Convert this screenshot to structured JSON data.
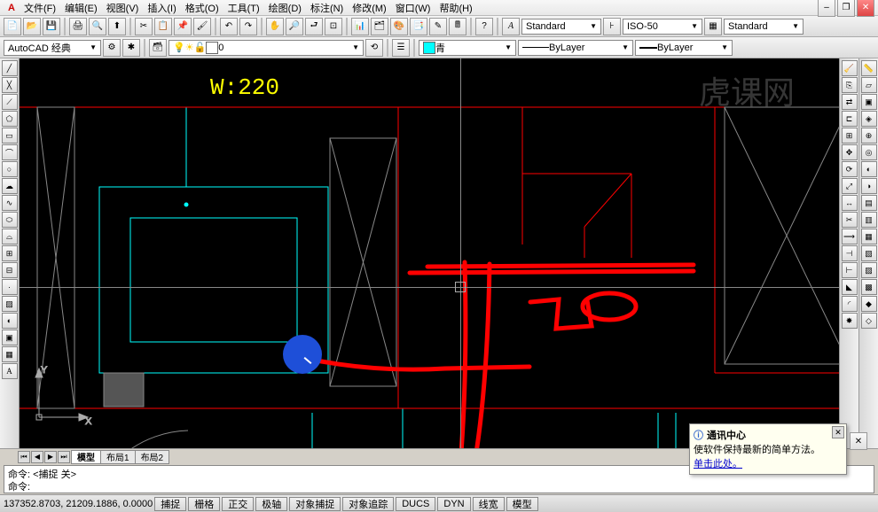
{
  "menu": {
    "file": "文件(F)",
    "edit": "编辑(E)",
    "view": "视图(V)",
    "insert": "插入(I)",
    "format": "格式(O)",
    "tools": "工具(T)",
    "draw": "绘图(D)",
    "dim": "标注(N)",
    "modify": "修改(M)",
    "window": "窗口(W)",
    "help": "帮助(H)"
  },
  "toolbar1": {
    "workspace": "AutoCAD 经典",
    "layervalue": "0"
  },
  "toolbar2": {
    "color_name": "青",
    "linetype": "ByLayer",
    "lineweight": "ByLayer",
    "textstyle": "Standard",
    "dimstyle": "ISO-50",
    "tablestyle": "Standard"
  },
  "drawing": {
    "dim_text": "W:220"
  },
  "tabs": {
    "model": "模型",
    "layout1": "布局1",
    "layout2": "布局2"
  },
  "cmd": {
    "hist": "命令: <捕捉 关>",
    "prompt": "命令: "
  },
  "status": {
    "coords": "137352.8703, 21209.1886, 0.0000",
    "snap": "捕捉",
    "grid": "栅格",
    "ortho": "正交",
    "polar": "极轴",
    "osnap": "对象捕捉",
    "otrack": "对象追踪",
    "ducs": "DUCS",
    "dyn": "DYN",
    "lwt": "线宽",
    "model": "模型"
  },
  "notif": {
    "title": "通讯中心",
    "body": "使软件保持最新的简单方法。",
    "link": "单击此处。"
  },
  "watermark": "虎课网",
  "winctl": {
    "min": "–",
    "max": "❐",
    "close": "✕"
  }
}
